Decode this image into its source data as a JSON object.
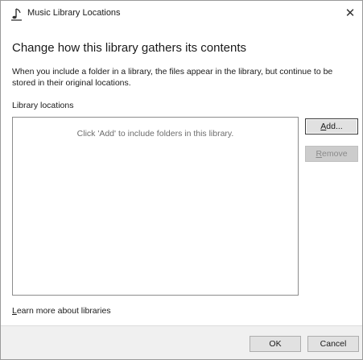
{
  "window": {
    "title": "Music Library Locations",
    "icon": "music-note-icon",
    "close_glyph": "✕"
  },
  "content": {
    "heading": "Change how this library gathers its contents",
    "description": "When you include a folder in a library, the files appear in the library, but continue to be stored in their original locations.",
    "locations_label": "Library locations",
    "empty_list_text": "Click 'Add' to include folders in this library."
  },
  "buttons": {
    "add": {
      "accel": "A",
      "rest": "dd..."
    },
    "remove": {
      "accel": "R",
      "rest": "emove",
      "enabled": false
    },
    "ok": "OK",
    "cancel": "Cancel"
  },
  "links": {
    "learn_more": {
      "accel": "L",
      "rest": "earn more about libraries"
    }
  },
  "colors": {
    "background": "#ffffff",
    "footer": "#f0f0f0",
    "disabled_text": "#8a8a8a",
    "hint_text": "#6d6d6d"
  }
}
